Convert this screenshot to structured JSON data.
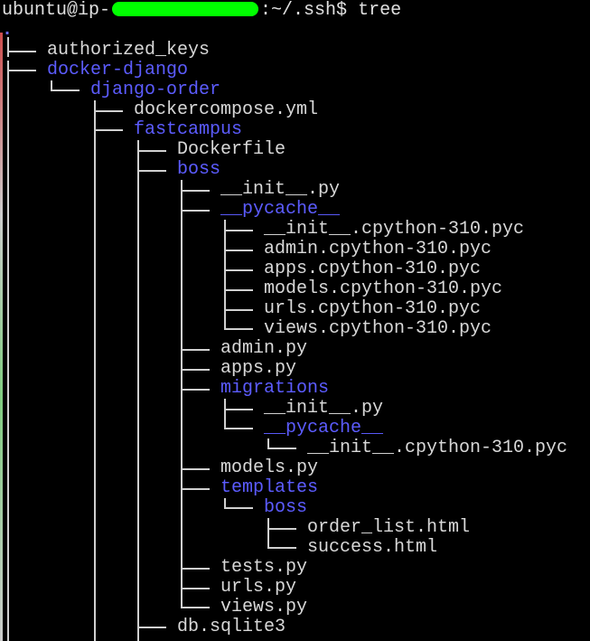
{
  "terminal": {
    "prompt_user_host_prefix": "ubuntu@ip-",
    "prompt_path": ":~/.ssh$",
    "command": "tree",
    "root": "."
  },
  "tree": [
    {
      "depth": 0,
      "name": "authorized_keys",
      "type": "file"
    },
    {
      "depth": 0,
      "name": "docker-django",
      "type": "dir"
    },
    {
      "depth": 1,
      "name": "django-order",
      "type": "dir"
    },
    {
      "depth": 2,
      "name": "dockercompose.yml",
      "type": "file"
    },
    {
      "depth": 2,
      "name": "fastcampus",
      "type": "dir"
    },
    {
      "depth": 3,
      "name": "Dockerfile",
      "type": "file"
    },
    {
      "depth": 3,
      "name": "boss",
      "type": "dir"
    },
    {
      "depth": 4,
      "name": "__init__.py",
      "type": "file"
    },
    {
      "depth": 4,
      "name": "__pycache__",
      "type": "dir"
    },
    {
      "depth": 5,
      "name": "__init__.cpython-310.pyc",
      "type": "file"
    },
    {
      "depth": 5,
      "name": "admin.cpython-310.pyc",
      "type": "file"
    },
    {
      "depth": 5,
      "name": "apps.cpython-310.pyc",
      "type": "file"
    },
    {
      "depth": 5,
      "name": "models.cpython-310.pyc",
      "type": "file"
    },
    {
      "depth": 5,
      "name": "urls.cpython-310.pyc",
      "type": "file"
    },
    {
      "depth": 5,
      "name": "views.cpython-310.pyc",
      "type": "file"
    },
    {
      "depth": 4,
      "name": "admin.py",
      "type": "file"
    },
    {
      "depth": 4,
      "name": "apps.py",
      "type": "file"
    },
    {
      "depth": 4,
      "name": "migrations",
      "type": "dir"
    },
    {
      "depth": 5,
      "name": "__init__.py",
      "type": "file"
    },
    {
      "depth": 5,
      "name": "__pycache__",
      "type": "dir"
    },
    {
      "depth": 6,
      "name": "__init__.cpython-310.pyc",
      "type": "file"
    },
    {
      "depth": 4,
      "name": "models.py",
      "type": "file"
    },
    {
      "depth": 4,
      "name": "templates",
      "type": "dir"
    },
    {
      "depth": 5,
      "name": "boss",
      "type": "dir"
    },
    {
      "depth": 6,
      "name": "order_list.html",
      "type": "file"
    },
    {
      "depth": 6,
      "name": "success.html",
      "type": "file"
    },
    {
      "depth": 4,
      "name": "tests.py",
      "type": "file"
    },
    {
      "depth": 4,
      "name": "urls.py",
      "type": "file"
    },
    {
      "depth": 4,
      "name": "views.py",
      "type": "file"
    },
    {
      "depth": 3,
      "name": "db.sqlite3",
      "type": "file"
    }
  ],
  "colors": {
    "background": "#000000",
    "file": "#d8d8d8",
    "dir": "#5c5cff",
    "redaction": "#00ff00"
  }
}
